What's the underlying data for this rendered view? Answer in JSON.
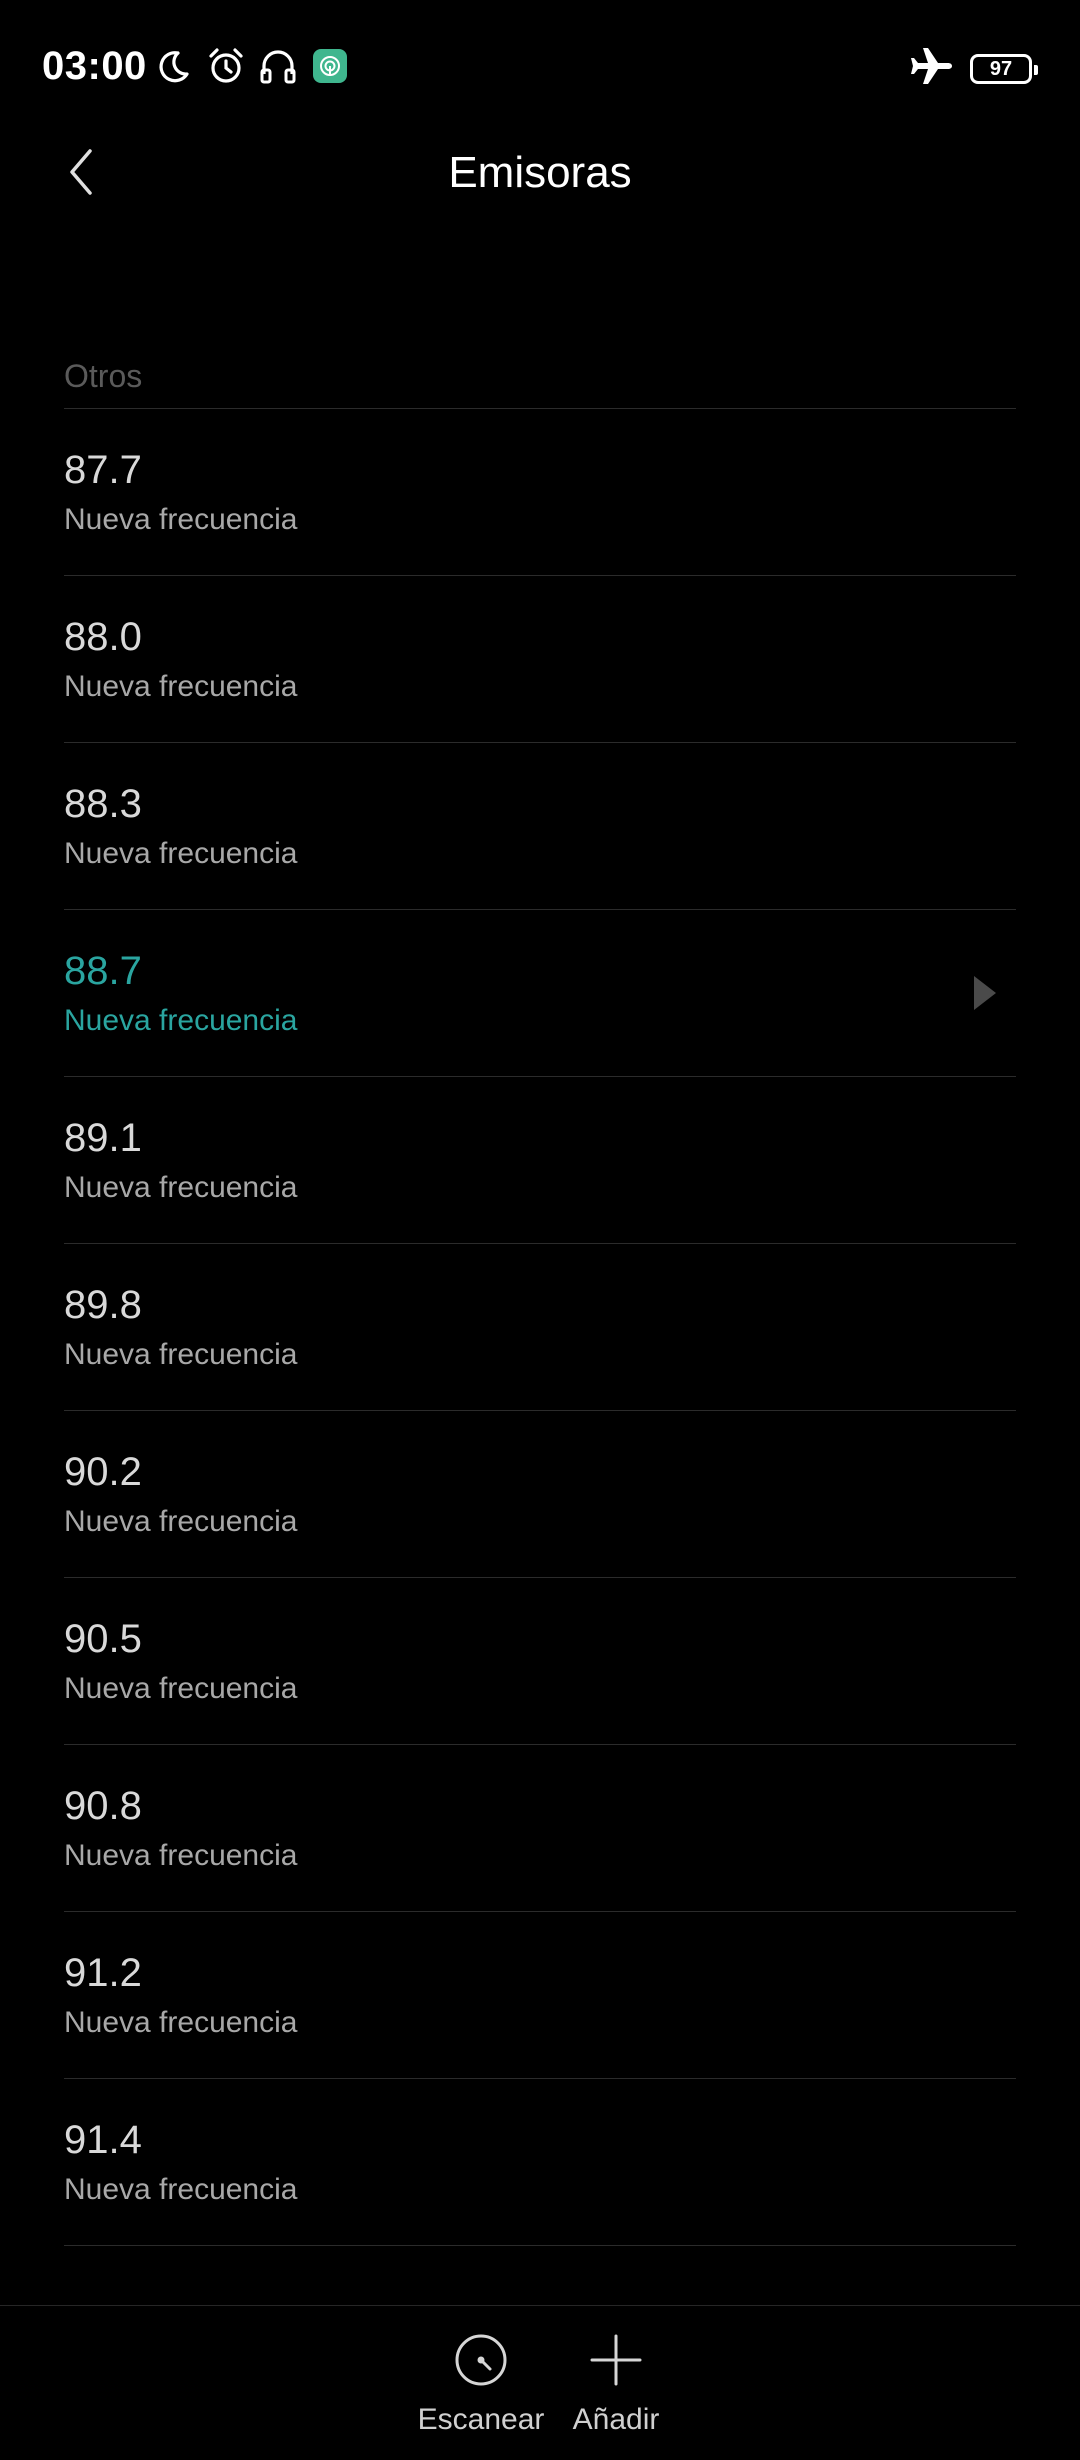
{
  "status_bar": {
    "time": "03:00",
    "battery_level": "97",
    "icons": [
      "moon-icon",
      "alarm-icon",
      "headphones-icon",
      "app-notification-icon",
      "airplane-mode-icon",
      "battery-icon"
    ],
    "app_icon_color": "#3fb68e"
  },
  "header": {
    "title": "Emisoras"
  },
  "section": {
    "label": "Otros"
  },
  "stations": [
    {
      "frequency": "87.7",
      "name": "Nueva frecuencia",
      "active": false
    },
    {
      "frequency": "88.0",
      "name": "Nueva frecuencia",
      "active": false
    },
    {
      "frequency": "88.3",
      "name": "Nueva frecuencia",
      "active": false
    },
    {
      "frequency": "88.7",
      "name": "Nueva frecuencia",
      "active": true
    },
    {
      "frequency": "89.1",
      "name": "Nueva frecuencia",
      "active": false
    },
    {
      "frequency": "89.8",
      "name": "Nueva frecuencia",
      "active": false
    },
    {
      "frequency": "90.2",
      "name": "Nueva frecuencia",
      "active": false
    },
    {
      "frequency": "90.5",
      "name": "Nueva frecuencia",
      "active": false
    },
    {
      "frequency": "90.8",
      "name": "Nueva frecuencia",
      "active": false
    },
    {
      "frequency": "91.2",
      "name": "Nueva frecuencia",
      "active": false
    },
    {
      "frequency": "91.4",
      "name": "Nueva frecuencia",
      "active": false
    }
  ],
  "bottom_bar": {
    "scan_label": "Escanear",
    "add_label": "Añadir"
  },
  "colors": {
    "background": "#000000",
    "accent": "#2aa5a0",
    "divider": "#2b2b2b"
  }
}
